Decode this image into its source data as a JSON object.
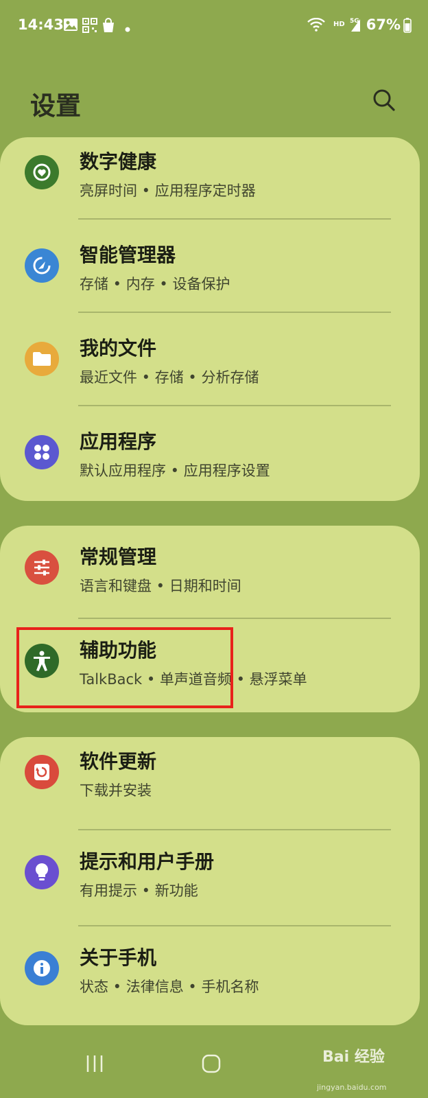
{
  "status_bar": {
    "time": "14:43",
    "hd": "HD",
    "network": "5G",
    "battery": "67%"
  },
  "header": {
    "title": "设置"
  },
  "cards": [
    {
      "items": [
        {
          "title": "数字健康",
          "subtitle": "亮屏时间 • 应用程序定时器",
          "icon": "digital-wellbeing-icon",
          "color": "#3c7a2c"
        },
        {
          "title": "智能管理器",
          "subtitle": "存储 • 内存 • 设备保护",
          "icon": "device-care-icon",
          "color": "#3a86d4"
        },
        {
          "title": "我的文件",
          "subtitle": "最近文件 • 存储 • 分析存储",
          "icon": "folder-icon",
          "color": "#e8aa3c"
        },
        {
          "title": "应用程序",
          "subtitle": "默认应用程序 • 应用程序设置",
          "icon": "apps-icon",
          "color": "#5b58d0"
        }
      ]
    },
    {
      "items": [
        {
          "title": "常规管理",
          "subtitle": "语言和键盘 • 日期和时间",
          "icon": "sliders-icon",
          "color": "#d9503f"
        },
        {
          "title": "辅助功能",
          "subtitle": "TalkBack • 单声道音频 • 悬浮菜单",
          "icon": "accessibility-icon",
          "color": "#2f6a28"
        }
      ]
    },
    {
      "items": [
        {
          "title": "软件更新",
          "subtitle": "下载并安装",
          "icon": "software-update-icon",
          "color": "#d94a3c"
        },
        {
          "title": "提示和用户手册",
          "subtitle": "有用提示 • 新功能",
          "icon": "lightbulb-icon",
          "color": "#6a4fd0"
        },
        {
          "title": "关于手机",
          "subtitle": "状态 • 法律信息 • 手机名称",
          "icon": "info-icon",
          "color": "#3a7fd4"
        }
      ]
    }
  ],
  "watermark": {
    "brand": "Bai 经验",
    "url": "jingyan.baidu.com"
  }
}
